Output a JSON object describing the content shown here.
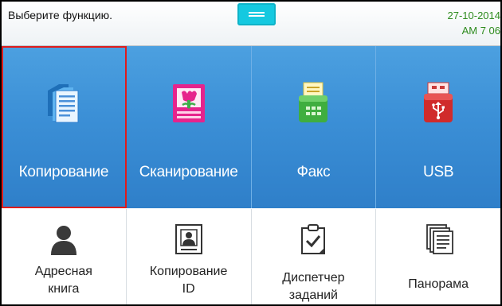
{
  "topbar": {
    "prompt": "Выберите функцию.",
    "date": "27-10-2014",
    "time": "AM 7  06"
  },
  "main_tiles": [
    {
      "name": "copy",
      "label": "Копирование",
      "icon": "copy-documents-icon",
      "selected": true
    },
    {
      "name": "scan",
      "label": "Сканирование",
      "icon": "scan-image-icon",
      "selected": false
    },
    {
      "name": "fax",
      "label": "Факс",
      "icon": "fax-machine-icon",
      "selected": false
    },
    {
      "name": "usb",
      "label": "USB",
      "icon": "usb-drive-icon",
      "selected": false
    }
  ],
  "sub_tiles": [
    {
      "name": "address-book",
      "line1": "Адресная",
      "line2": "книга",
      "icon": "person-icon"
    },
    {
      "name": "id-copy",
      "line1": "Копирование",
      "line2": "ID",
      "icon": "id-card-icon"
    },
    {
      "name": "job-manager",
      "line1": "Диспетчер",
      "line2": "заданий",
      "icon": "clipboard-check-icon"
    },
    {
      "name": "panorama",
      "line1": "Панорама",
      "line2": "",
      "icon": "pages-stack-icon"
    }
  ],
  "colors": {
    "tile_blue": "#3b8fd6",
    "selection_red": "#e01b1b",
    "handle_cyan": "#15c9e0",
    "datetime_green": "#2e8b1e"
  }
}
